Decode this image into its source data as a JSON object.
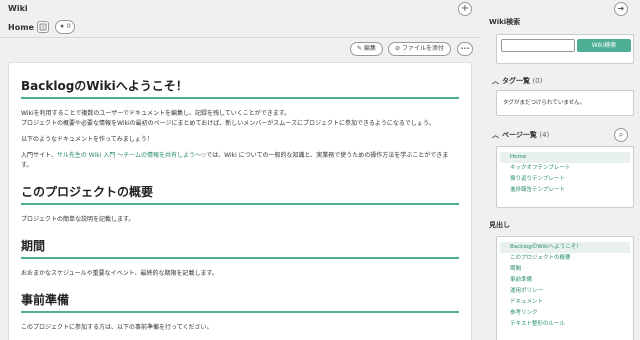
{
  "header": {
    "title": "Wiki",
    "add_icon": "plus-icon",
    "collapse_icon": "arrow-right-icon"
  },
  "page": {
    "name": "Home",
    "star_count": "0"
  },
  "actions": {
    "edit_label": "編集",
    "attach_label": "ファイルを添付",
    "more_label": "•••"
  },
  "content": {
    "h1": "BacklogのWikiへようこそ！",
    "intro1": "Wikiを利用することで複数のユーザーでドキュメントを編集し、記録を残していくことができます。",
    "intro2": "プロジェクトの概要や必要な情報をWikiの最初のページにまとめておけば、新しいメンバーがスムーズにプロジェクトに参加できるようになるでしょう。",
    "intro3": "以下のようなドキュメントを作ってみましょう！",
    "intro4_pre": "入門サイト、",
    "intro4_link": "サル先生の Wiki 入門 〜チームの情報を共有しよう〜",
    "intro4_post": "では、Wiki についての一般的な知識と、実業務で使うための操作方法を学ぶことができます。",
    "h2_overview": "このプロジェクトの概要",
    "overview_text": "プロジェクトの簡単な説明を記載します。",
    "h2_period": "期間",
    "period_text": "おおまかなスケジュールや重要なイベント、最終的な期限を記載します。",
    "h2_prep": "事前準備",
    "prep_text": "このプロジェクトに参加する方は、以下の事前準備を行ってください。"
  },
  "sidebar": {
    "search_label": "Wiki検索",
    "search_placeholder": "",
    "search_button": "Wiki検索",
    "tags_title": "タグ一覧",
    "tags_count": "(0)",
    "tags_empty": "タグがまだつけられていません。",
    "pages_title": "ページ一覧",
    "pages_count": "(4)",
    "pages": [
      "Home",
      "キックオフテンプレート",
      "振り返りテンプレート",
      "進捗報告テンプレート"
    ],
    "toc_title": "見出し",
    "toc": [
      "BacklogのWikiへようこそ！",
      "このプロジェクトの概要",
      "期間",
      "事前準備",
      "運用ポリシー",
      "ドキュメント",
      "参考リンク",
      "テキスト整形のルール"
    ]
  },
  "colors": {
    "accent": "#4caf93",
    "link": "#2a8c6d"
  }
}
